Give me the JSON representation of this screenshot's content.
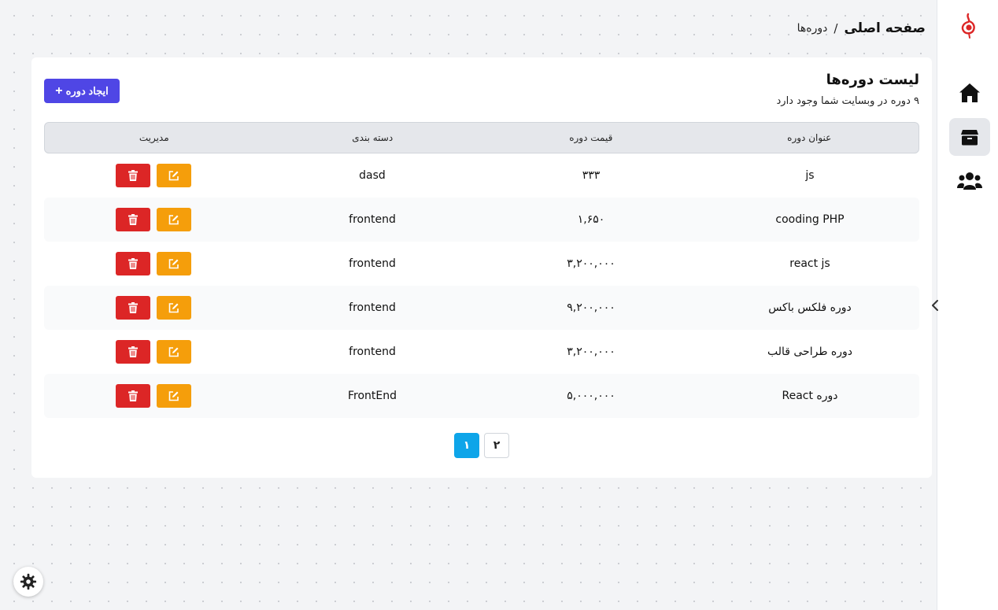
{
  "breadcrumb": {
    "home": "صفحه اصلی",
    "separator": "/",
    "current": "دوره‌ها"
  },
  "card": {
    "title": "لیست دوره‌ها",
    "subtitle": "۹ دوره در وبسایت شما وجود دارد",
    "create_button": "ایجاد دوره",
    "create_icon": "+"
  },
  "table": {
    "headers": {
      "title": "عنوان دوره",
      "price": "قیمت دوره",
      "category": "دسته بندی",
      "actions": "مدیریت"
    },
    "rows": [
      {
        "title": "js",
        "price": "۳۳۳",
        "category": "dasd"
      },
      {
        "title": "cooding PHP",
        "price": "۱,۶۵۰",
        "category": "frontend"
      },
      {
        "title": "react js",
        "price": "۳,۲۰۰,۰۰۰",
        "category": "frontend"
      },
      {
        "title": "دوره فلکس باکس",
        "price": "۹,۲۰۰,۰۰۰",
        "category": "frontend"
      },
      {
        "title": "دوره طراحی قالب",
        "price": "۳,۲۰۰,۰۰۰",
        "category": "frontend"
      },
      {
        "title": "دوره React",
        "price": "۵,۰۰۰,۰۰۰",
        "category": "FrontEnd"
      }
    ]
  },
  "pagination": {
    "pages": [
      "۱",
      "۲"
    ],
    "active": "۱"
  },
  "icons": {
    "logo": "logo-icon",
    "home": "home-icon",
    "courses": "box-icon",
    "users": "users-icon",
    "edit": "edit-icon",
    "delete": "trash-icon",
    "collapse": "chevron-left-icon",
    "settings": "gear-icon"
  },
  "colors": {
    "primary": "#4f46e5",
    "delete": "#dc2626",
    "edit": "#f59e0b",
    "page_active": "#0ea5e9",
    "logo": "#dc2626"
  }
}
